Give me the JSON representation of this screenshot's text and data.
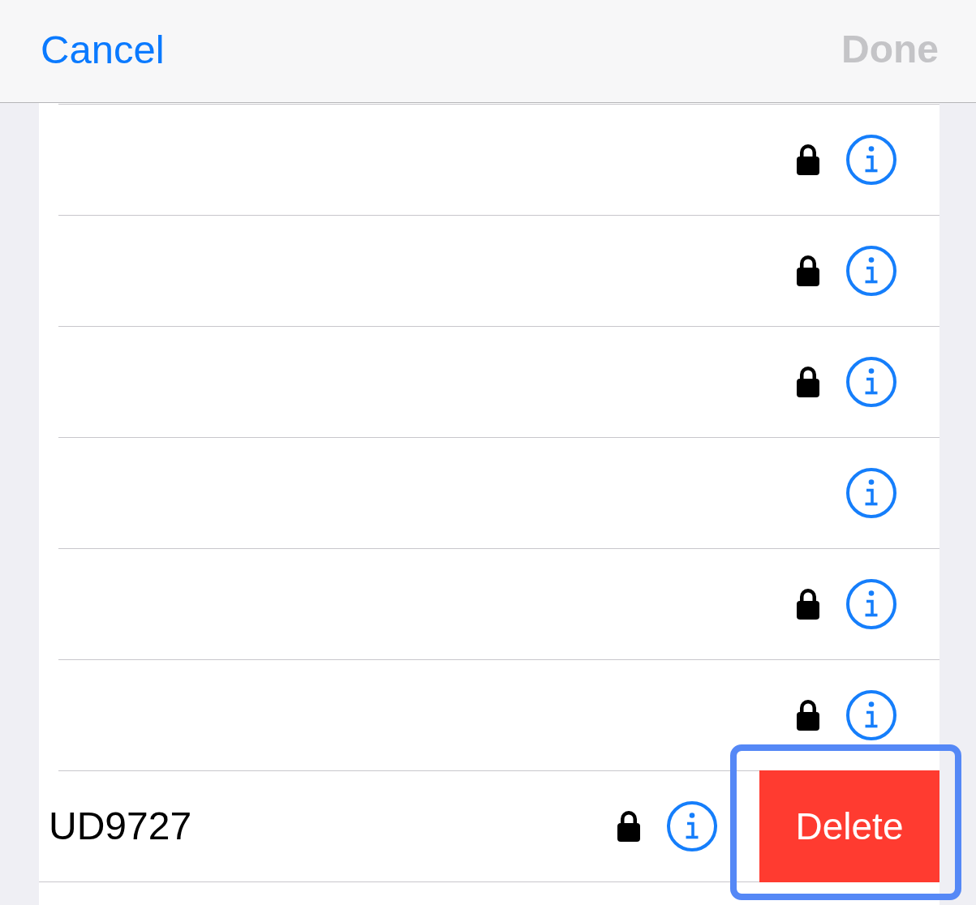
{
  "nav": {
    "cancel": {
      "label": "Cancel"
    },
    "done": {
      "label": "Done",
      "disabled": true
    }
  },
  "rows": [
    {
      "kind": "plain",
      "locked": true
    },
    {
      "kind": "plain",
      "locked": true
    },
    {
      "kind": "plain",
      "locked": true
    },
    {
      "kind": "plain",
      "locked": false
    },
    {
      "kind": "plain",
      "locked": true
    },
    {
      "kind": "plain",
      "locked": true
    },
    {
      "kind": "swiped",
      "label": "UD9727",
      "locked": true,
      "action": {
        "label": "Delete",
        "highlighted": true
      }
    }
  ]
}
